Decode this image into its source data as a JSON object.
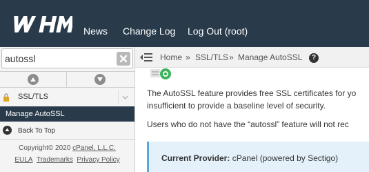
{
  "header": {
    "logo_text": "WHM",
    "nav": [
      "News",
      "Change Log",
      "Log Out (root)"
    ]
  },
  "sidebar": {
    "search_value": "autossl",
    "group_label": "SSL/TLS",
    "active_item": "Manage AutoSSL",
    "back_to_top": "Back To Top",
    "copyright": "Copyright© 2020",
    "company": "cPanel, L.L.C.",
    "links": [
      "EULA",
      "Trademarks",
      "Privacy Policy"
    ]
  },
  "breadcrumb": {
    "items": [
      "Home",
      "SSL/TLS",
      "Manage AutoSSL"
    ],
    "separator": "»"
  },
  "main": {
    "para1_line1": "The AutoSSL feature provides free SSL certificates for yo",
    "para1_line2": "insufficient to provide a baseline level of security.",
    "para2": "Users who do not have the “autossl” feature will not rec",
    "provider_label": "Current Provider:",
    "provider_value": "cPanel (powered by Sectigo)"
  },
  "colors": {
    "header_bg": "#293a4a",
    "active_bg": "#293a4a",
    "provider_bg": "#e4f1fa",
    "provider_border": "#5aa7dd",
    "logo_green": "#3cb45a"
  }
}
